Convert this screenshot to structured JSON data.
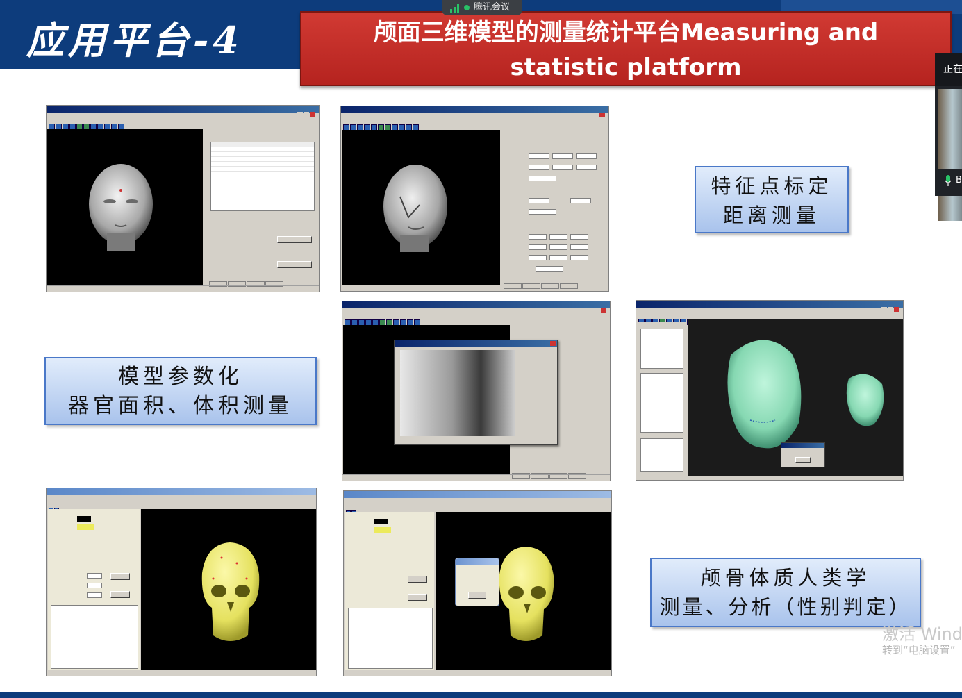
{
  "header": {
    "app_title": "应用平台-4",
    "banner_line1": "颅面三维模型的测量统计平台Measuring and",
    "banner_line2": "statistic platform"
  },
  "meeting": {
    "label": "腾讯会议",
    "status_color": "#29c267"
  },
  "side_panel": {
    "header_text": "正在",
    "footer_text": "B"
  },
  "captions": {
    "feature": {
      "line1": "特征点标定",
      "line2": "距离测量"
    },
    "model": {
      "line1": "模型参数化",
      "line2": "器官面积、体积测量"
    },
    "skull": {
      "line1": "颅骨体质人类学",
      "line2": "测量、分析（性别判定）"
    }
  },
  "watermark": {
    "line1": "激活 Wind",
    "line2": "转到“电脑设置”"
  },
  "colors": {
    "header_blue": "#0d3c7c",
    "banner_red": "#c32b27",
    "caption_border": "#4a78c8",
    "skull_yellow": "#eeea72",
    "face_green": "#8fe0bf"
  }
}
